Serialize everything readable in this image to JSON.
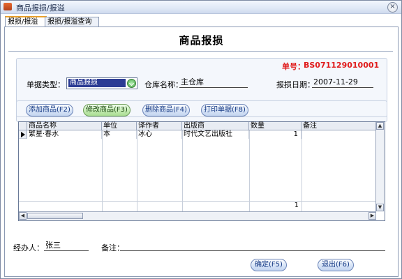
{
  "window": {
    "title": "商品报损/报溢",
    "close_glyph": "×"
  },
  "tabs": [
    {
      "label": "报损/报溢",
      "active": true
    },
    {
      "label": "报损/报溢查询",
      "active": false
    }
  ],
  "form": {
    "heading": "商品报损",
    "doc_no_label": "单号：",
    "doc_no": "BS071129010001",
    "doc_type_label": "单据类型：",
    "doc_type_value": "商品报损",
    "warehouse_label": "仓库名称：",
    "warehouse_value": "主仓库",
    "date_label": "报损日期：",
    "date_value": "2007-11-29"
  },
  "actions": {
    "add": "添加商品(F2)",
    "edit": "修改商品(F3)",
    "delete": "删除商品(F4)",
    "print": "打印单据(F8)"
  },
  "grid": {
    "columns": [
      "商品名称",
      "单位",
      "译作者",
      "出版商",
      "数量",
      "备注"
    ],
    "rows": [
      {
        "name": "繁星·春水",
        "unit": "本",
        "author": "冰心",
        "publisher": "时代文艺出版社",
        "qty": "1",
        "note": ""
      }
    ],
    "total_qty": "1"
  },
  "footer": {
    "handler_label": "经办人：",
    "handler_value": "张三",
    "remark_label": "备注：",
    "remark_value": "",
    "ok": "确定(F5)",
    "exit": "退出(F6)"
  },
  "colors": {
    "accent": "#e01b1b",
    "selection": "#2c3c94"
  }
}
